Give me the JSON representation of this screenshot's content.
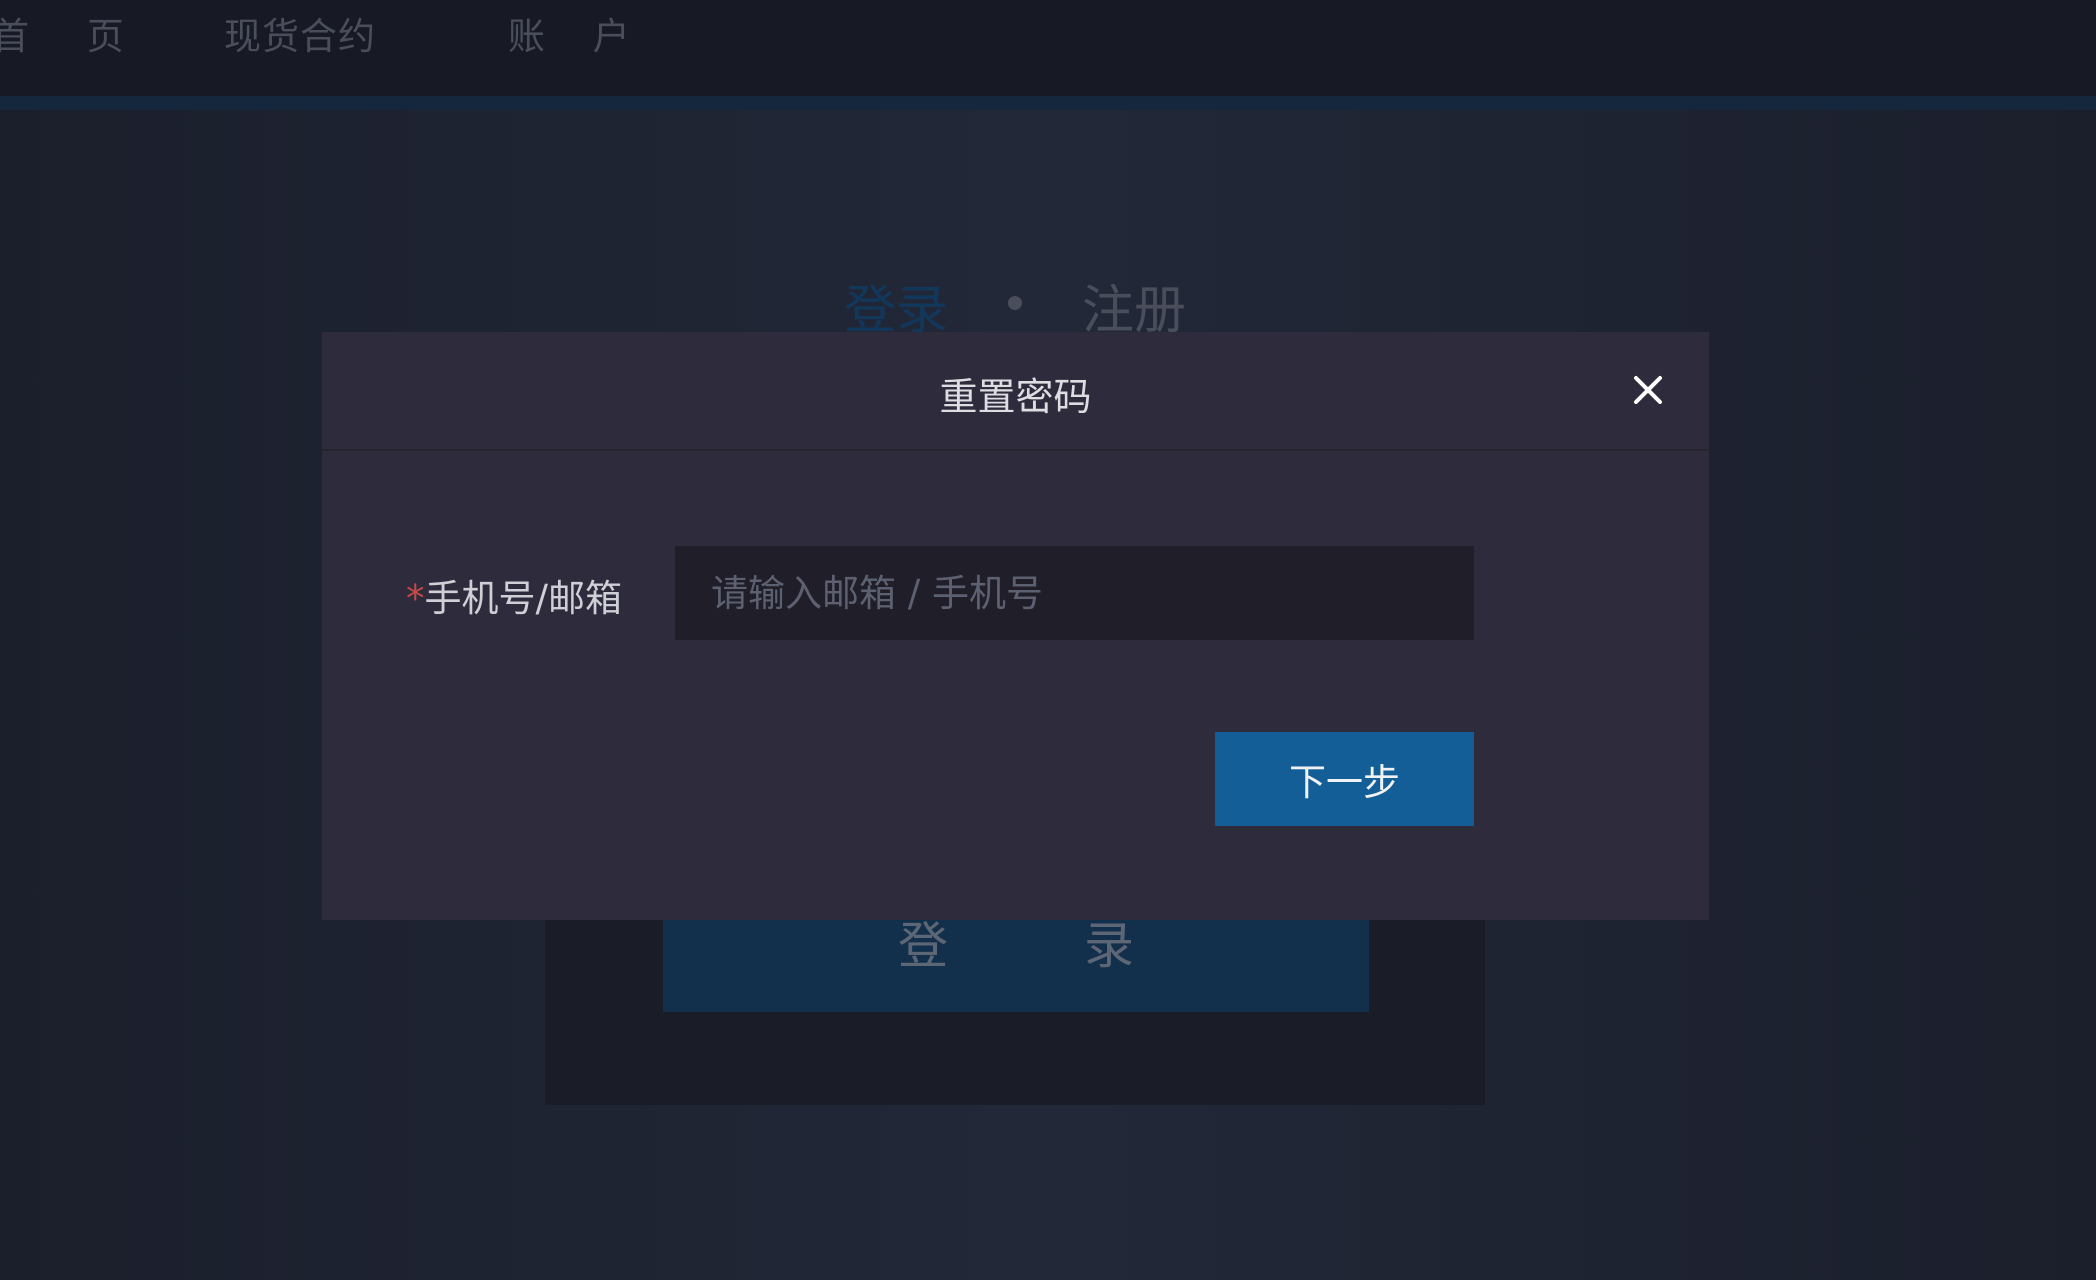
{
  "nav": {
    "items": [
      {
        "label": "首 页"
      },
      {
        "label": "现货合约"
      },
      {
        "label": "账 户"
      }
    ]
  },
  "auth_tabs": {
    "login": "登录",
    "register": "注册"
  },
  "login_card": {
    "login_button": "登 录"
  },
  "modal": {
    "title": "重置密码",
    "field": {
      "required_mark": "*",
      "label": "手机号/邮箱",
      "placeholder": "请输入邮箱 / 手机号",
      "value": ""
    },
    "next_button": "下一步"
  },
  "colors": {
    "accent": "#135e96",
    "required": "#c24a4a",
    "modal_bg": "#2d2b3c"
  }
}
